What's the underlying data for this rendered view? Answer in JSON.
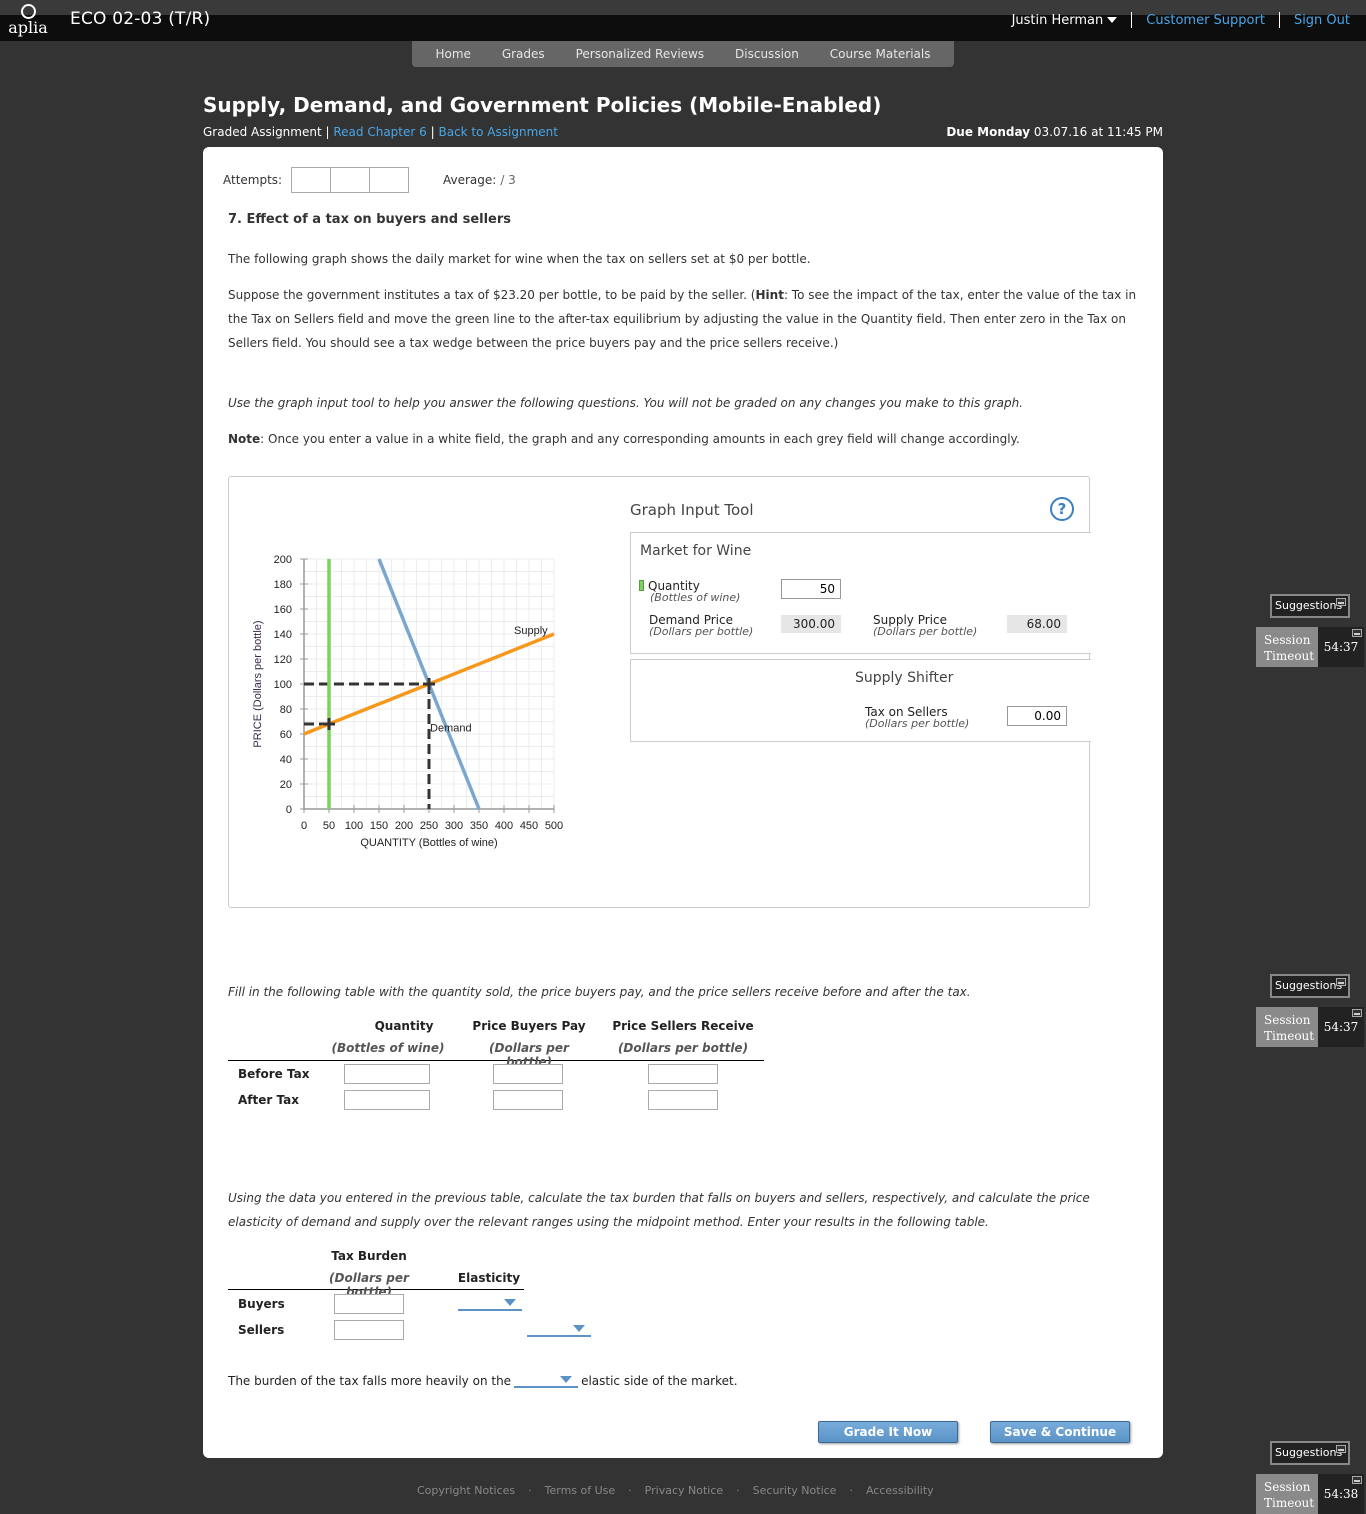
{
  "header": {
    "logo_text": "aplia",
    "course_title": "ECO 02-03 (T/R)",
    "user_name": "Justin Herman",
    "customer_support": "Customer Support",
    "sign_out": "Sign Out"
  },
  "nav": {
    "items": [
      "Home",
      "Grades",
      "Personalized Reviews",
      "Discussion",
      "Course Materials"
    ]
  },
  "assignment": {
    "title": "Supply, Demand, and Government Policies (Mobile-Enabled)",
    "type": "Graded Assignment",
    "sep": "|",
    "read_chapter": "Read Chapter 6",
    "back": "Back to Assignment",
    "due_label": "Due Monday",
    "due_value": "03.07.16 at 11:45 PM"
  },
  "attempts": {
    "label": "Attempts:",
    "average_label": "Average:",
    "average_value": "/ 3"
  },
  "question": {
    "title": "7. Effect of a tax on buyers and sellers",
    "p1": "The following graph shows the daily market for wine when the tax on sellers set at $0 per bottle.",
    "p2_a": "Suppose the government institutes a tax of $23.20 per bottle, to be paid by the seller. (",
    "p2_hint": "Hint",
    "p2_b": ": To see the impact of the tax, enter the value of the tax in the Tax on Sellers field and move the green line to the after-tax equilibrium by adjusting the value in the Quantity field. Then enter zero in the Tax on Sellers field. You should see a tax wedge between the price buyers pay and the price sellers receive.)",
    "p3": "Use the graph input tool to help you answer the following questions. You will not be graded on any changes you make to this graph.",
    "note_label": "Note",
    "note_text": ": Once you enter a value in a white field, the graph and any corresponding amounts in each grey field will change accordingly."
  },
  "graph_tool": {
    "title": "Graph Input Tool",
    "help": "?",
    "market_title": "Market for Wine",
    "quantity_label": "Quantity",
    "quantity_unit": "(Bottles of wine)",
    "quantity_value": "50",
    "demand_price_label": "Demand Price",
    "demand_price_unit": "(Dollars per bottle)",
    "demand_price_value": "300.00",
    "supply_price_label": "Supply Price",
    "supply_price_unit": "(Dollars per bottle)",
    "supply_price_value": "68.00",
    "shifter_title": "Supply Shifter",
    "tax_label": "Tax on Sellers",
    "tax_unit": "(Dollars per bottle)",
    "tax_value": "0.00",
    "colors": {
      "quantity_line": "#7dd35a",
      "supply": "#f7981d",
      "demand": "#7ba7cf",
      "guides": "#333333"
    }
  },
  "chart_data": {
    "type": "line",
    "title": "",
    "xlabel": "QUANTITY (Bottles of wine)",
    "ylabel": "PRICE (Dollars per bottle)",
    "xlim": [
      0,
      500
    ],
    "ylim": [
      0,
      200
    ],
    "xticks": [
      0,
      50,
      100,
      150,
      200,
      250,
      300,
      350,
      400,
      450,
      500
    ],
    "yticks": [
      0,
      20,
      40,
      60,
      80,
      100,
      120,
      140,
      160,
      180,
      200
    ],
    "grid": true,
    "series": [
      {
        "name": "Supply",
        "points": [
          [
            0,
            60
          ],
          [
            500,
            140
          ]
        ],
        "color": "#f7981d",
        "label_at": [
          420,
          140
        ]
      },
      {
        "name": "Demand",
        "points": [
          [
            150,
            200
          ],
          [
            350,
            0
          ]
        ],
        "color": "#7ba7cf",
        "label_at": [
          252,
          62
        ]
      },
      {
        "name": "Quantity",
        "points": [
          [
            50,
            0
          ],
          [
            50,
            200
          ]
        ],
        "color": "#7dd35a"
      }
    ],
    "markers": [
      {
        "name": "equilibrium",
        "x": 250,
        "y": 100
      },
      {
        "name": "supply-price-at-quantity",
        "x": 50,
        "y": 68
      }
    ]
  },
  "table1": {
    "intro": "Fill in the following table with the quantity sold, the price buyers pay, and the price sellers receive before and after the tax.",
    "headers": [
      {
        "title": "Quantity",
        "unit": "(Bottles of wine)"
      },
      {
        "title": "Price Buyers Pay",
        "unit": "(Dollars per bottle)"
      },
      {
        "title": "Price Sellers Receive",
        "unit": "(Dollars per bottle)"
      }
    ],
    "rows": [
      {
        "label": "Before Tax",
        "values": [
          "",
          "",
          ""
        ]
      },
      {
        "label": "After Tax",
        "values": [
          "",
          "",
          ""
        ]
      }
    ]
  },
  "table2": {
    "intro": "Using the data you entered in the previous table, calculate the tax burden that falls on buyers and sellers, respectively, and calculate the price elasticity of demand and supply over the relevant ranges using the midpoint method. Enter your results in the following table.",
    "col1_title": "Tax Burden",
    "col1_unit": "(Dollars per bottle)",
    "col2_title": "Elasticity",
    "rows": [
      {
        "label": "Buyers",
        "burden": "",
        "elasticity": ""
      },
      {
        "label": "Sellers",
        "burden": "",
        "elasticity": ""
      }
    ]
  },
  "conclusion": {
    "before": "The burden of the tax falls more heavily on the",
    "selected": "",
    "after": "elastic side of the market."
  },
  "buttons": {
    "grade": "Grade It Now",
    "save": "Save & Continue"
  },
  "footer": {
    "links": [
      "Copyright Notices",
      "Terms of Use",
      "Privacy Notice",
      "Security Notice",
      "Accessibility"
    ],
    "sep": "·"
  },
  "widgets": [
    {
      "suggestions": "Suggestions",
      "session_label_1": "Session",
      "session_label_2": "Timeout",
      "time": "54:37"
    },
    {
      "suggestions": "Suggestions",
      "session_label_1": "Session",
      "session_label_2": "Timeout",
      "time": "54:37"
    },
    {
      "suggestions": "Suggestions",
      "session_label_1": "Session",
      "session_label_2": "Timeout",
      "time": "54:38"
    }
  ]
}
